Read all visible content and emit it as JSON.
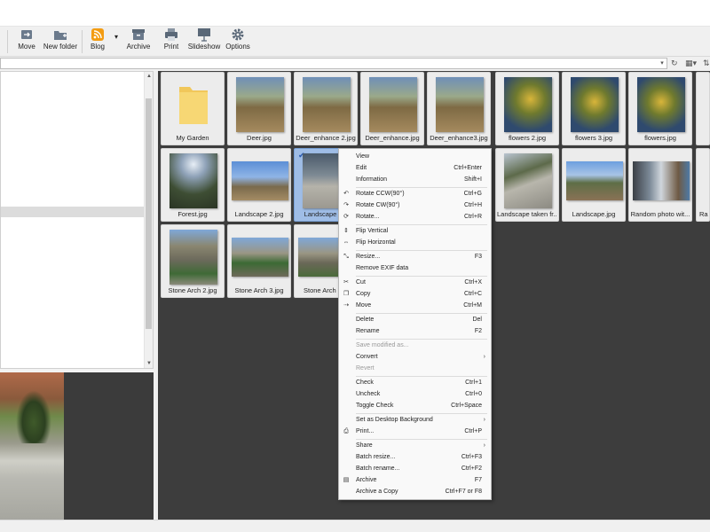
{
  "toolbar": {
    "buttons": [
      {
        "id": "move",
        "label": "Move",
        "icon": "move-icon"
      },
      {
        "id": "new_folder",
        "label": "New folder",
        "icon": "new-folder-icon"
      },
      {
        "id": "blog",
        "label": "Blog",
        "icon": "rss-icon"
      },
      {
        "id": "archive",
        "label": "Archive",
        "icon": "archive-icon"
      },
      {
        "id": "print",
        "label": "Print",
        "icon": "printer-icon"
      },
      {
        "id": "slideshow",
        "label": "Slideshow",
        "icon": "slideshow-icon"
      },
      {
        "id": "options",
        "label": "Options",
        "icon": "gear-icon"
      }
    ]
  },
  "thumbnails": [
    {
      "label": "My Garden",
      "type": "folder"
    },
    {
      "label": "Deer.jpg",
      "type": "photo"
    },
    {
      "label": "Deer_enhance 2.jpg",
      "type": "photo"
    },
    {
      "label": "Deer_enhance.jpg",
      "type": "photo"
    },
    {
      "label": "Deer_enhance3.jpg",
      "type": "photo"
    },
    {
      "label": "flowers 2.jpg",
      "type": "photo"
    },
    {
      "label": "flowers 3.jpg",
      "type": "photo"
    },
    {
      "label": "flowers.jpg",
      "type": "photo"
    },
    {
      "label": "Forest.jpg",
      "type": "photo"
    },
    {
      "label": "Landscape 2.jpg",
      "type": "photo"
    },
    {
      "label": "Landscape tak",
      "type": "photo",
      "selected": true,
      "checked": true
    },
    {
      "label": "Landscape taken fr...",
      "type": "photo"
    },
    {
      "label": "Landscape.jpg",
      "type": "photo"
    },
    {
      "label": "Random photo wit...",
      "type": "photo"
    },
    {
      "label": "Ra",
      "type": "photo"
    },
    {
      "label": "Stone Arch 2.jpg",
      "type": "photo"
    },
    {
      "label": "Stone Arch 3.jpg",
      "type": "photo"
    },
    {
      "label": "Stone Arch",
      "type": "photo"
    }
  ],
  "context_menu": {
    "items": [
      {
        "label": "View",
        "shortcut": ""
      },
      {
        "label": "Edit",
        "shortcut": "Ctrl+Enter"
      },
      {
        "label": "Information",
        "shortcut": "Shift+I"
      },
      {
        "label": "Rotate CCW(90°)",
        "shortcut": "Ctrl+G",
        "icon": "rotate-ccw-icon"
      },
      {
        "label": "Rotate CW(90°)",
        "shortcut": "Ctrl+H",
        "icon": "rotate-cw-icon"
      },
      {
        "label": "Rotate...",
        "shortcut": "Ctrl+R",
        "icon": "rotate-icon"
      },
      {
        "label": "Flip Vertical",
        "shortcut": "",
        "icon": "flip-vertical-icon"
      },
      {
        "label": "Flip Horizontal",
        "shortcut": "",
        "icon": "flip-horizontal-icon"
      },
      {
        "label": "Resize...",
        "shortcut": "F3",
        "icon": "resize-icon"
      },
      {
        "label": "Remove EXIF data",
        "shortcut": ""
      },
      {
        "label": "Cut",
        "shortcut": "Ctrl+X",
        "icon": "scissors-icon"
      },
      {
        "label": "Copy",
        "shortcut": "Ctrl+C",
        "icon": "copy-icon"
      },
      {
        "label": "Move",
        "shortcut": "Ctrl+M",
        "icon": "move-icon"
      },
      {
        "label": "Delete",
        "shortcut": "Del"
      },
      {
        "label": "Rename",
        "shortcut": "F2"
      },
      {
        "label": "Save modified as...",
        "shortcut": "",
        "disabled": true
      },
      {
        "label": "Convert",
        "shortcut": "",
        "submenu": true
      },
      {
        "label": "Revert",
        "shortcut": "",
        "disabled": true
      },
      {
        "label": "Check",
        "shortcut": "Ctrl+1"
      },
      {
        "label": "Uncheck",
        "shortcut": "Ctrl+0"
      },
      {
        "label": "Toggle Check",
        "shortcut": "Ctrl+Space"
      },
      {
        "label": "Set as Desktop Background",
        "shortcut": "",
        "submenu": true
      },
      {
        "label": "Print...",
        "shortcut": "Ctrl+P",
        "icon": "printer-icon"
      },
      {
        "label": "Share",
        "shortcut": "",
        "submenu": true
      },
      {
        "label": "Batch resize...",
        "shortcut": "Ctrl+F3"
      },
      {
        "label": "Batch rename...",
        "shortcut": "Ctrl+F2"
      },
      {
        "label": "Archive",
        "shortcut": "F7",
        "icon": "archive-icon"
      },
      {
        "label": "Archive a Copy",
        "shortcut": "Ctrl+F7 or F8"
      }
    ]
  }
}
